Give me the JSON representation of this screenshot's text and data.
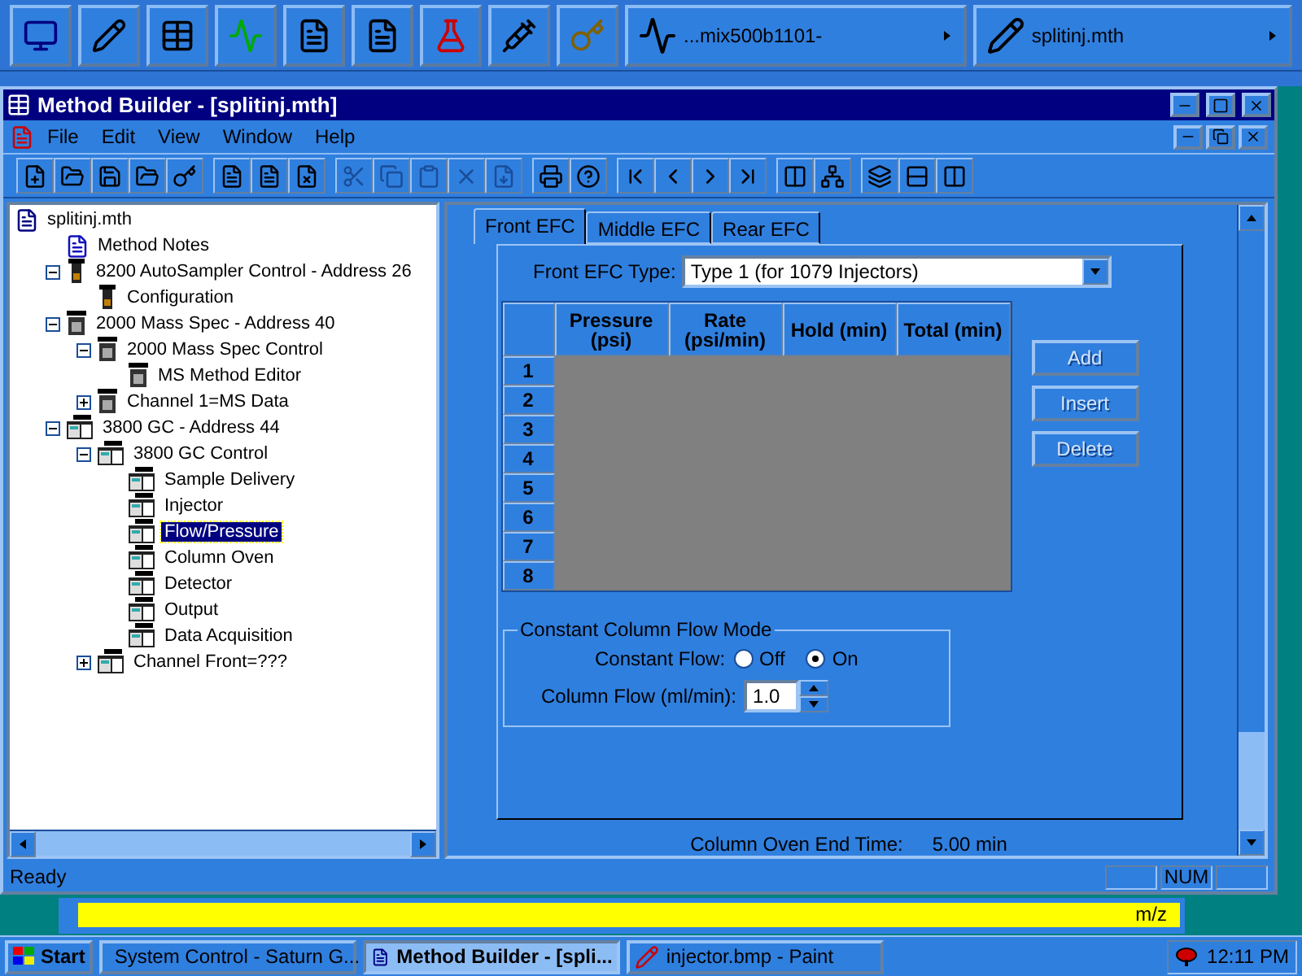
{
  "launch_bar": {
    "tasks": [
      {
        "label": "...mix500b1101-"
      },
      {
        "label": "splitinj.mth"
      }
    ]
  },
  "window": {
    "title": "Method Builder - [splitinj.mth]"
  },
  "menu": [
    "File",
    "Edit",
    "View",
    "Window",
    "Help"
  ],
  "tree": [
    {
      "label": "splitinj.mth",
      "kind": "file",
      "selected": false,
      "children": [
        {
          "label": "Method Notes",
          "kind": "notes",
          "selected": false
        },
        {
          "label": "8200 AutoSampler Control - Address 26",
          "kind": "sampler",
          "selected": false,
          "expanded": true,
          "children": [
            {
              "label": "Configuration",
              "kind": "sampler",
              "selected": false
            }
          ]
        },
        {
          "label": "2000 Mass Spec - Address 40",
          "kind": "ms",
          "selected": false,
          "expanded": true,
          "children": [
            {
              "label": "2000 Mass Spec Control",
              "kind": "ms",
              "selected": false,
              "expanded": true,
              "children": [
                {
                  "label": "MS Method Editor",
                  "kind": "ms",
                  "selected": false
                }
              ]
            },
            {
              "label": "Channel 1=MS Data",
              "kind": "ms",
              "selected": false,
              "expanded": false
            }
          ]
        },
        {
          "label": "3800 GC - Address 44",
          "kind": "gc",
          "selected": false,
          "expanded": true,
          "children": [
            {
              "label": "3800 GC Control",
              "kind": "gc",
              "selected": false,
              "expanded": true,
              "children": [
                {
                  "label": "Sample Delivery",
                  "kind": "gc",
                  "selected": false
                },
                {
                  "label": "Injector",
                  "kind": "gc",
                  "selected": false
                },
                {
                  "label": "Flow/Pressure",
                  "kind": "gc",
                  "selected": true
                },
                {
                  "label": "Column Oven",
                  "kind": "gc",
                  "selected": false
                },
                {
                  "label": "Detector",
                  "kind": "gc",
                  "selected": false
                },
                {
                  "label": "Output",
                  "kind": "gc",
                  "selected": false
                },
                {
                  "label": "Data Acquisition",
                  "kind": "gc",
                  "selected": false
                }
              ]
            },
            {
              "label": "Channel Front=???",
              "kind": "gc",
              "selected": false,
              "expanded": false
            }
          ]
        }
      ]
    }
  ],
  "tabs": [
    {
      "label": "Front EFC",
      "selected": true
    },
    {
      "label": "Middle EFC",
      "selected": false
    },
    {
      "label": "Rear EFC",
      "selected": false
    }
  ],
  "efc_type": {
    "label": "Front EFC Type:",
    "value": "Type 1 (for 1079 Injectors)"
  },
  "table": {
    "columns": [
      "Pressure (psi)",
      "Rate (psi/min)",
      "Hold (min)",
      "Total (min)"
    ],
    "rows": [
      "1",
      "2",
      "3",
      "4",
      "5",
      "6",
      "7",
      "8"
    ]
  },
  "buttons": [
    {
      "label": "Add",
      "disabled": true
    },
    {
      "label": "Insert",
      "disabled": true
    },
    {
      "label": "Delete",
      "disabled": true
    }
  ],
  "flow_group": {
    "title": "Constant Column Flow Mode",
    "constant_flow": {
      "label": "Constant Flow:",
      "options": [
        {
          "label": "Off",
          "selected": false
        },
        {
          "label": "On",
          "selected": true
        }
      ]
    },
    "column_flow": {
      "label": "Column Flow (ml/min):",
      "value": "1.0"
    }
  },
  "end_time": {
    "label": "Column Oven End Time:",
    "value": "5.00 min"
  },
  "status_bar": {
    "text": "Ready",
    "panels": [
      "NUM"
    ]
  },
  "background_window": {
    "text": "m/z"
  },
  "taskbar": {
    "start": "Start",
    "tasks": [
      {
        "label": "System Control - Saturn G...",
        "selected": false,
        "kind": "system"
      },
      {
        "label": "Method Builder - [spli...",
        "selected": true,
        "kind": "method"
      },
      {
        "label": "injector.bmp - Paint",
        "selected": false,
        "kind": "paint"
      }
    ],
    "clock": "12:11 PM"
  }
}
